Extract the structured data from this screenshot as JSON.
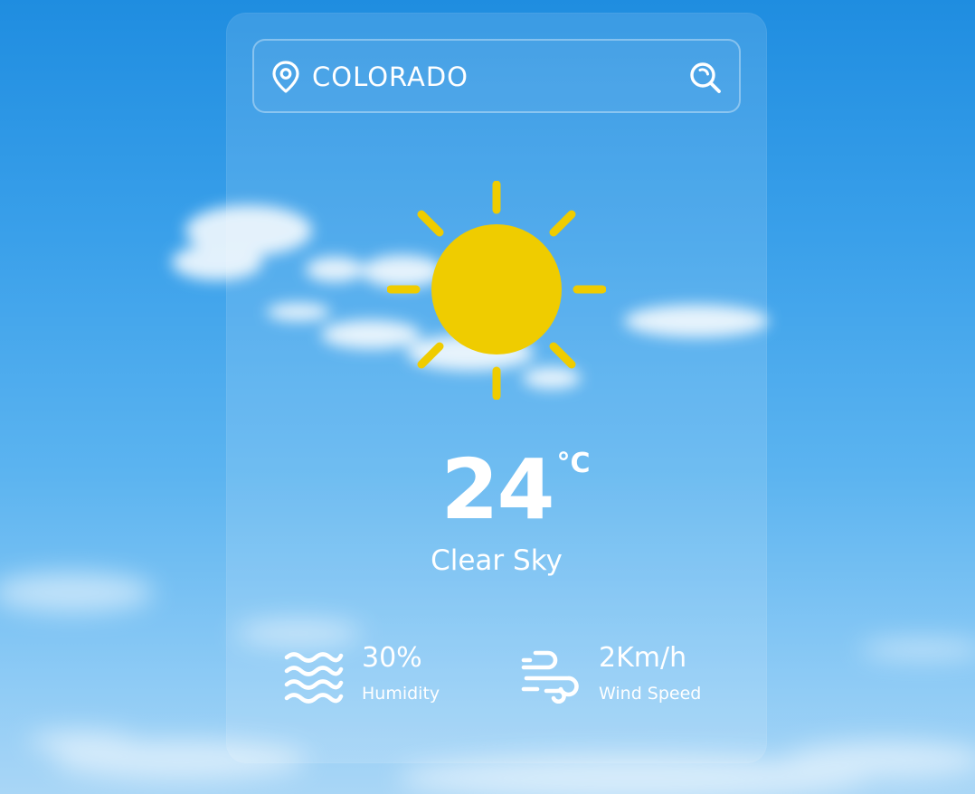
{
  "location": {
    "value": "COLORADO",
    "icon": "map-pin-icon"
  },
  "search": {
    "icon": "search-icon"
  },
  "weather": {
    "icon": "sun-icon",
    "temperature": "24",
    "unit": "°C",
    "condition": "Clear Sky"
  },
  "stats": {
    "humidity": {
      "value": "30%",
      "label": "Humidity",
      "icon": "waves-icon"
    },
    "wind": {
      "value": "2Km/h",
      "label": "Wind Speed",
      "icon": "wind-icon"
    }
  },
  "colors": {
    "sky_top": "#1f8de0",
    "sky_bottom": "#a9d6f6",
    "sun": "#efcc00",
    "text": "#ffffff"
  }
}
